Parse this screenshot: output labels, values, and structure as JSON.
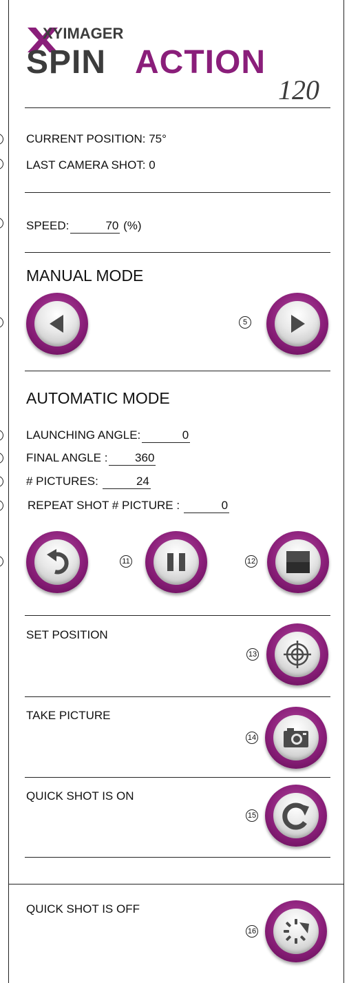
{
  "logo": {
    "brand": "XYIMAGER",
    "title_part1": "SPIN",
    "title_part2": "ACTION",
    "model": "120",
    "colors": {
      "dark": "#3c3c3c",
      "purple": "#8a1e7a"
    }
  },
  "status": {
    "current_position": "CURRENT POSITION: 75°",
    "last_camera_shot": "LAST CAMERA SHOT: 0"
  },
  "speed": {
    "label": "SPEED:",
    "value": "70",
    "unit": "(%)"
  },
  "manual": {
    "title": "MANUAL MODE",
    "right_number": "5"
  },
  "automatic": {
    "title": "AUTOMATIC MODE",
    "launching_angle": {
      "label": "LAUNCHING ANGLE:",
      "value": "0"
    },
    "final_angle": {
      "label": "FINAL ANGLE :",
      "value": "360"
    },
    "pictures": {
      "label": "# PICTURES:",
      "value": "24"
    },
    "repeat_shot": {
      "label": "REPEAT SHOT # PICTURE :",
      "value": "0"
    },
    "pause_number": "11",
    "stop_number": "12"
  },
  "set_position": {
    "label": "SET POSITION",
    "number": "13"
  },
  "take_picture": {
    "label": "TAKE PICTURE",
    "number": "14"
  },
  "quick_shot_on": {
    "label": "QUICK SHOT IS ON",
    "number": "15"
  },
  "quick_shot_off": {
    "label": "QUICK SHOT IS OFF",
    "number": "16"
  },
  "icons": [
    "arrow-left-icon",
    "arrow-right-icon",
    "undo-icon",
    "pause-icon",
    "stop-icon",
    "crosshair-icon",
    "camera-icon",
    "refresh-icon",
    "loading-icon"
  ],
  "colors": {
    "button_ring": "#8b1f7a",
    "button_face": "#e6e6e6",
    "icon_gray": "#4a4a4a"
  }
}
